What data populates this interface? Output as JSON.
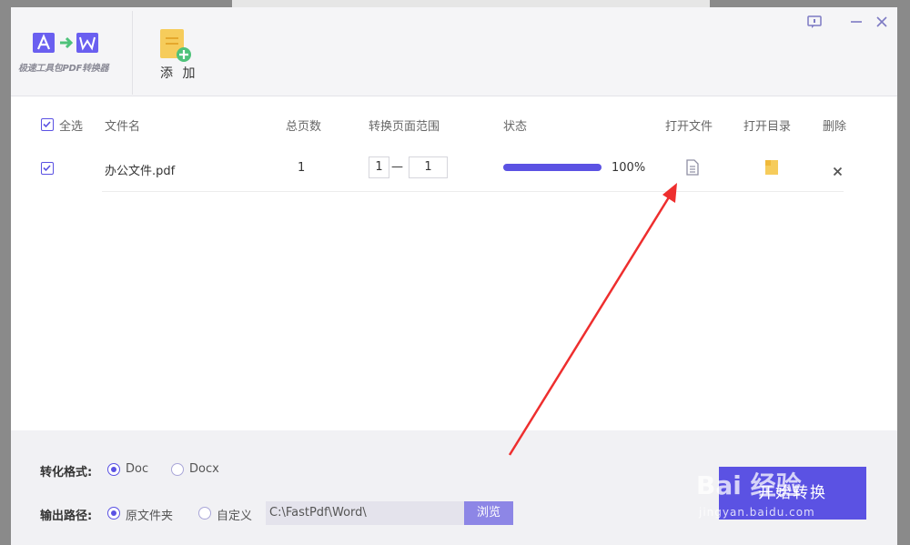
{
  "app": {
    "name": "极速工具包PDF转换器",
    "colors": {
      "accent": "#5b52e3",
      "arrow": "#ee2e2e",
      "icon_gray": "#8f8fa3",
      "folder_yellow": "#f6cc5b"
    }
  },
  "toolbar": {
    "add_label": "添 加",
    "window_icons": [
      "feedback-icon",
      "minimize-icon",
      "close-icon"
    ]
  },
  "table": {
    "select_all": {
      "label": "全选",
      "checked": true
    },
    "headers": {
      "filename": "文件名",
      "pages": "总页数",
      "range": "转换页面范围",
      "status": "状态",
      "open_file": "打开文件",
      "open_dir": "打开目录",
      "delete": "删除"
    },
    "rows": [
      {
        "checked": true,
        "filename": "办公文件.pdf",
        "pages": "1",
        "range_from": "1",
        "range_sep": "—",
        "range_to": "1",
        "progress": 1.0,
        "percent": "100%",
        "open_file_icon": "document-icon",
        "open_dir_icon": "folder-icon",
        "delete_icon": "close-icon"
      }
    ]
  },
  "settings": {
    "format_label": "转化格式:",
    "format_options": [
      {
        "label": "Doc",
        "selected": true
      },
      {
        "label": "Docx",
        "selected": false
      }
    ],
    "output_label": "输出路径:",
    "output_options": [
      {
        "label": "原文件夹",
        "selected": true
      },
      {
        "label": "自定义",
        "selected": false
      }
    ],
    "path_value": "C:\\FastPdf\\Word\\",
    "browse_label": "浏览",
    "convert_label": "开始转换"
  },
  "watermark": {
    "brand": "Bai 经验",
    "url": "jingyan.baidu.com"
  }
}
